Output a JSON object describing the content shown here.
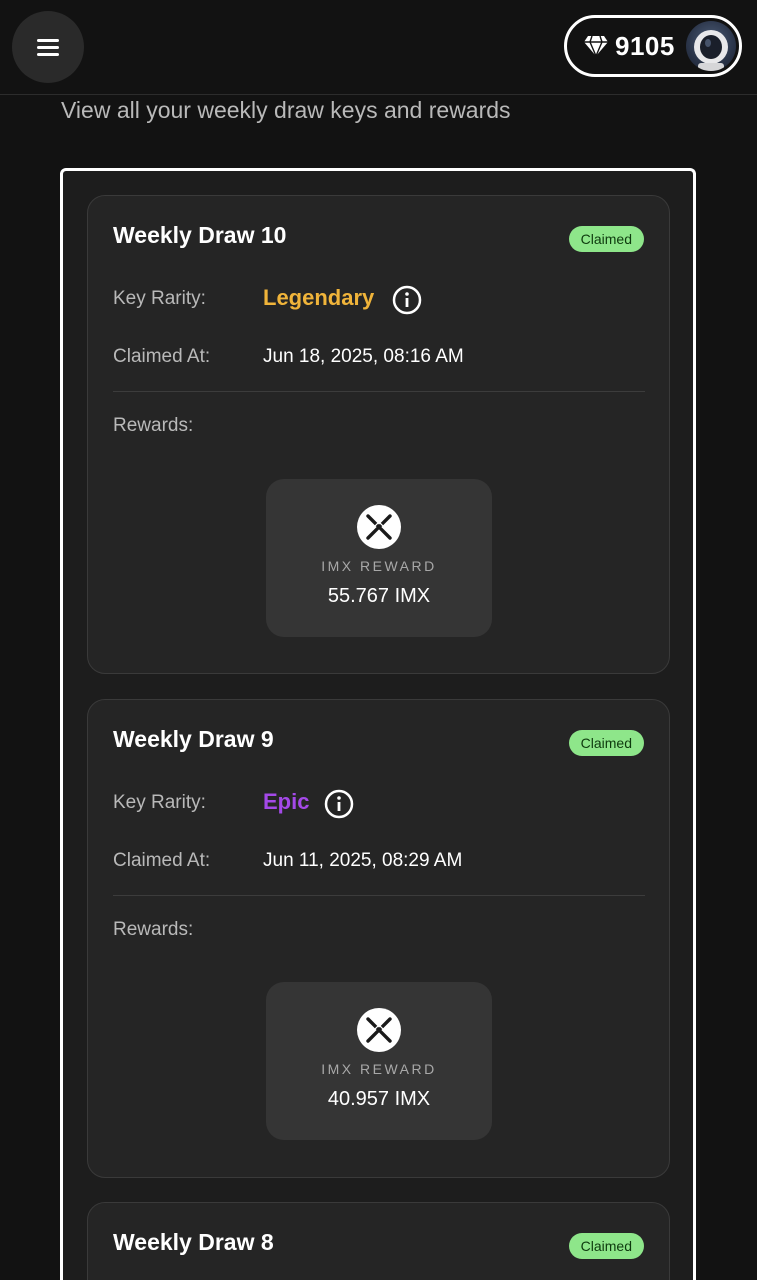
{
  "header": {
    "points": "9105",
    "menu_icon": "hamburger-menu-icon",
    "points_icon": "diamond-icon"
  },
  "subtitle": "View all your weekly draw keys and rewards",
  "labels": {
    "key_rarity": "Key Rarity:",
    "claimed_at": "Claimed At:",
    "rewards": "Rewards:"
  },
  "draws": [
    {
      "title": "Weekly Draw 10",
      "status": "Claimed",
      "rarity": "Legendary",
      "rarity_color": "#f0b43a",
      "claimed_at": "Jun 18, 2025, 08:16 AM",
      "reward": {
        "name": "IMX REWARD",
        "amount": "55.767 IMX"
      }
    },
    {
      "title": "Weekly Draw 9",
      "status": "Claimed",
      "rarity": "Epic",
      "rarity_color": "#a449e8",
      "claimed_at": "Jun 11, 2025, 08:29 AM",
      "reward": {
        "name": "IMX REWARD",
        "amount": "40.957 IMX"
      }
    },
    {
      "title": "Weekly Draw 8",
      "status": "Claimed"
    }
  ],
  "colors": {
    "background": "#121212",
    "card": "#252525",
    "badge": "#8ee68a"
  }
}
